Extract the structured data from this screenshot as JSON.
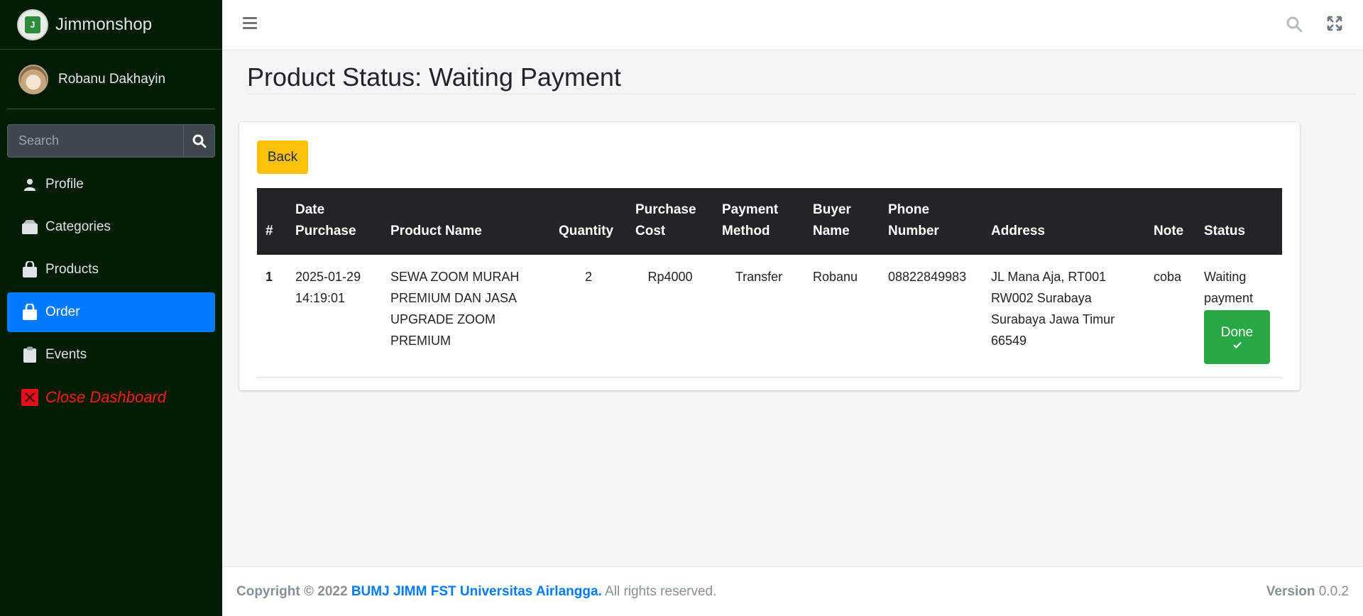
{
  "brand": {
    "name": "Jimmonshop",
    "logo_icon": "shop-bag-logo"
  },
  "user": {
    "name": "Robanu Dakhayin"
  },
  "sidebar": {
    "search_placeholder": "Search",
    "items": [
      {
        "label": "Profile",
        "icon": "person-icon"
      },
      {
        "label": "Categories",
        "icon": "box-icon"
      },
      {
        "label": "Products",
        "icon": "bag-icon"
      },
      {
        "label": "Order",
        "icon": "bag-icon",
        "active": true
      },
      {
        "label": "Events",
        "icon": "clipboard-icon"
      },
      {
        "label": "Close Dashboard",
        "icon": "close-x-icon"
      }
    ]
  },
  "page": {
    "title": "Product Status: Waiting Payment"
  },
  "actions": {
    "back_label": "Back",
    "done_label": "Done"
  },
  "table": {
    "headers": [
      "#",
      "Date Purchase",
      "Product Name",
      "Quantity",
      "Purchase Cost",
      "Payment Method",
      "Buyer Name",
      "Phone Number",
      "Address",
      "Note",
      "Status"
    ],
    "rows": [
      {
        "num": "1",
        "date": "2025-01-29 14:19:01",
        "product": "SEWA ZOOM MURAH PREMIUM DAN JASA UPGRADE ZOOM PREMIUM",
        "quantity": "2",
        "cost": "Rp4000",
        "payment": "Transfer",
        "buyer": "Robanu",
        "phone": "08822849983",
        "address": "JL Mana Aja, RT001 RW002 Surabaya Surabaya Jawa Timur 66549",
        "note": "coba",
        "status": "Waiting payment"
      }
    ]
  },
  "footer": {
    "copyright_prefix": "Copyright © 2022",
    "org": "BUMJ JIMM FST Universitas Airlangga.",
    "rights": "All rights reserved.",
    "version_label": "Version",
    "version": "0.0.2"
  },
  "colors": {
    "sidebar_bg": "#031c03",
    "active": "#007bff",
    "back_button": "#ffc107",
    "done_button": "#28a745",
    "close_dashboard": "#ff1a1a"
  }
}
